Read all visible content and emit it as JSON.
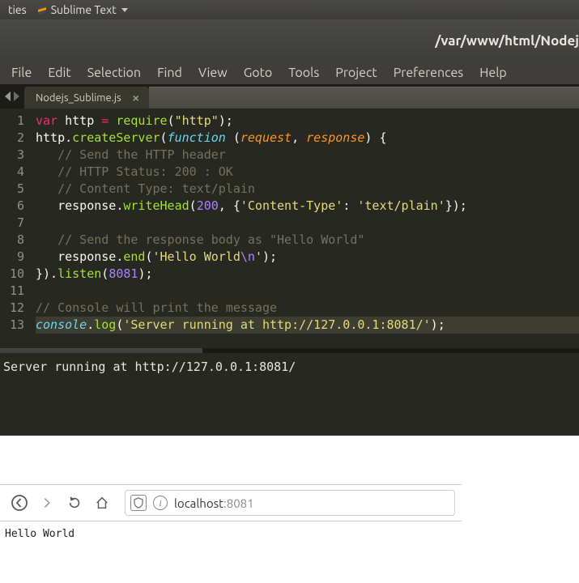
{
  "top_bar": {
    "left_cut": "ties",
    "app_name": "Sublime Text"
  },
  "title_bar": {
    "path": "/var/www/html/Nodej"
  },
  "menu": [
    "File",
    "Edit",
    "Selection",
    "Find",
    "View",
    "Goto",
    "Tools",
    "Project",
    "Preferences",
    "Help"
  ],
  "tab": {
    "label": "Nodejs_Sublime.js"
  },
  "code": {
    "line_count": 13,
    "lines": [
      [
        {
          "t": "kw",
          "v": "var"
        },
        {
          "t": "punct",
          "v": " "
        },
        {
          "t": "var",
          "v": "http"
        },
        {
          "t": "punct",
          "v": " "
        },
        {
          "t": "kw",
          "v": "="
        },
        {
          "t": "punct",
          "v": " "
        },
        {
          "t": "func",
          "v": "require"
        },
        {
          "t": "punct",
          "v": "("
        },
        {
          "t": "str",
          "v": "\"http\""
        },
        {
          "t": "punct",
          "v": ");"
        }
      ],
      [
        {
          "t": "var",
          "v": "http"
        },
        {
          "t": "punct",
          "v": "."
        },
        {
          "t": "func",
          "v": "createServer"
        },
        {
          "t": "punct",
          "v": "("
        },
        {
          "t": "def",
          "v": "function"
        },
        {
          "t": "punct",
          "v": " ("
        },
        {
          "t": "param",
          "v": "request"
        },
        {
          "t": "punct",
          "v": ", "
        },
        {
          "t": "param",
          "v": "response"
        },
        {
          "t": "punct",
          "v": ") {"
        }
      ],
      [
        {
          "t": "punct",
          "v": "   "
        },
        {
          "t": "cmt",
          "v": "// Send the HTTP header"
        }
      ],
      [
        {
          "t": "punct",
          "v": "   "
        },
        {
          "t": "cmt",
          "v": "// HTTP Status: 200 : OK"
        }
      ],
      [
        {
          "t": "punct",
          "v": "   "
        },
        {
          "t": "cmt",
          "v": "// Content Type: text/plain"
        }
      ],
      [
        {
          "t": "punct",
          "v": "   "
        },
        {
          "t": "var",
          "v": "response"
        },
        {
          "t": "punct",
          "v": "."
        },
        {
          "t": "func",
          "v": "writeHead"
        },
        {
          "t": "punct",
          "v": "("
        },
        {
          "t": "num",
          "v": "200"
        },
        {
          "t": "punct",
          "v": ", {"
        },
        {
          "t": "str",
          "v": "'Content-Type'"
        },
        {
          "t": "punct",
          "v": ": "
        },
        {
          "t": "str",
          "v": "'text/plain'"
        },
        {
          "t": "punct",
          "v": "});"
        }
      ],
      [
        {
          "t": "punct",
          "v": ""
        }
      ],
      [
        {
          "t": "punct",
          "v": "   "
        },
        {
          "t": "cmt",
          "v": "// Send the response body as \"Hello World\""
        }
      ],
      [
        {
          "t": "punct",
          "v": "   "
        },
        {
          "t": "var",
          "v": "response"
        },
        {
          "t": "punct",
          "v": "."
        },
        {
          "t": "func",
          "v": "end"
        },
        {
          "t": "punct",
          "v": "("
        },
        {
          "t": "str",
          "v": "'Hello World"
        },
        {
          "t": "esc",
          "v": "\\n"
        },
        {
          "t": "str",
          "v": "'"
        },
        {
          "t": "punct",
          "v": ");"
        }
      ],
      [
        {
          "t": "punct",
          "v": "})."
        },
        {
          "t": "func",
          "v": "listen"
        },
        {
          "t": "punct",
          "v": "("
        },
        {
          "t": "num",
          "v": "8081"
        },
        {
          "t": "punct",
          "v": ");"
        }
      ],
      [
        {
          "t": "punct",
          "v": ""
        }
      ],
      [
        {
          "t": "cmt",
          "v": "// Console will print the message"
        }
      ],
      [
        {
          "t": "def",
          "v": "console"
        },
        {
          "t": "punct",
          "v": "."
        },
        {
          "t": "func",
          "v": "log"
        },
        {
          "t": "punct",
          "v": "("
        },
        {
          "t": "str",
          "v": "'Server running at http://127.0.0.1:8081/'"
        },
        {
          "t": "punct",
          "v": ");"
        }
      ]
    ],
    "highlighted_line": 13
  },
  "console_output": "Server running at http://127.0.0.1:8081/",
  "browser": {
    "host": "localhost",
    "port": ":8081",
    "body": "Hello World"
  }
}
